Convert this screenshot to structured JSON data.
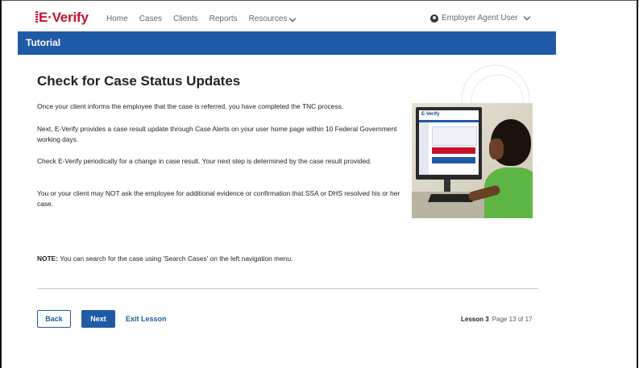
{
  "nav": {
    "logo": "E·Verify",
    "links": [
      "Home",
      "Cases",
      "Clients",
      "Reports",
      "Resources"
    ],
    "user": "Employer Agent User"
  },
  "tutorial_bar": {
    "title": "Tutorial"
  },
  "content": {
    "title": "Check for Case Status Updates",
    "paragraphs": [
      "Once your client informs the employee that the case is referred, you have completed the TNC process.",
      "Next, E-Verify provides a case result update through Case Alerts on your user home page within 10 Federal Government working days.",
      "Check E-Verify periodically for a change in case result. Your next step is determined by the case result provided.",
      "You or your client may NOT ask the employee for additional evidence or confirmation that SSA or DHS resolved his or her case."
    ],
    "note_label": "NOTE:",
    "note_text": " You can search for the case using 'Search Cases' on the left navigation menu.",
    "photo_screen_logo": "E·Verify"
  },
  "footer": {
    "back": "Back",
    "next": "Next",
    "exit": "Exit Lesson",
    "lesson": "Lesson 3",
    "page": "Page 13 of 17"
  },
  "colors": {
    "brand_blue": "#1f5aa6",
    "brand_red": "#c8102e",
    "logo_blue": "#1a3f8b"
  }
}
